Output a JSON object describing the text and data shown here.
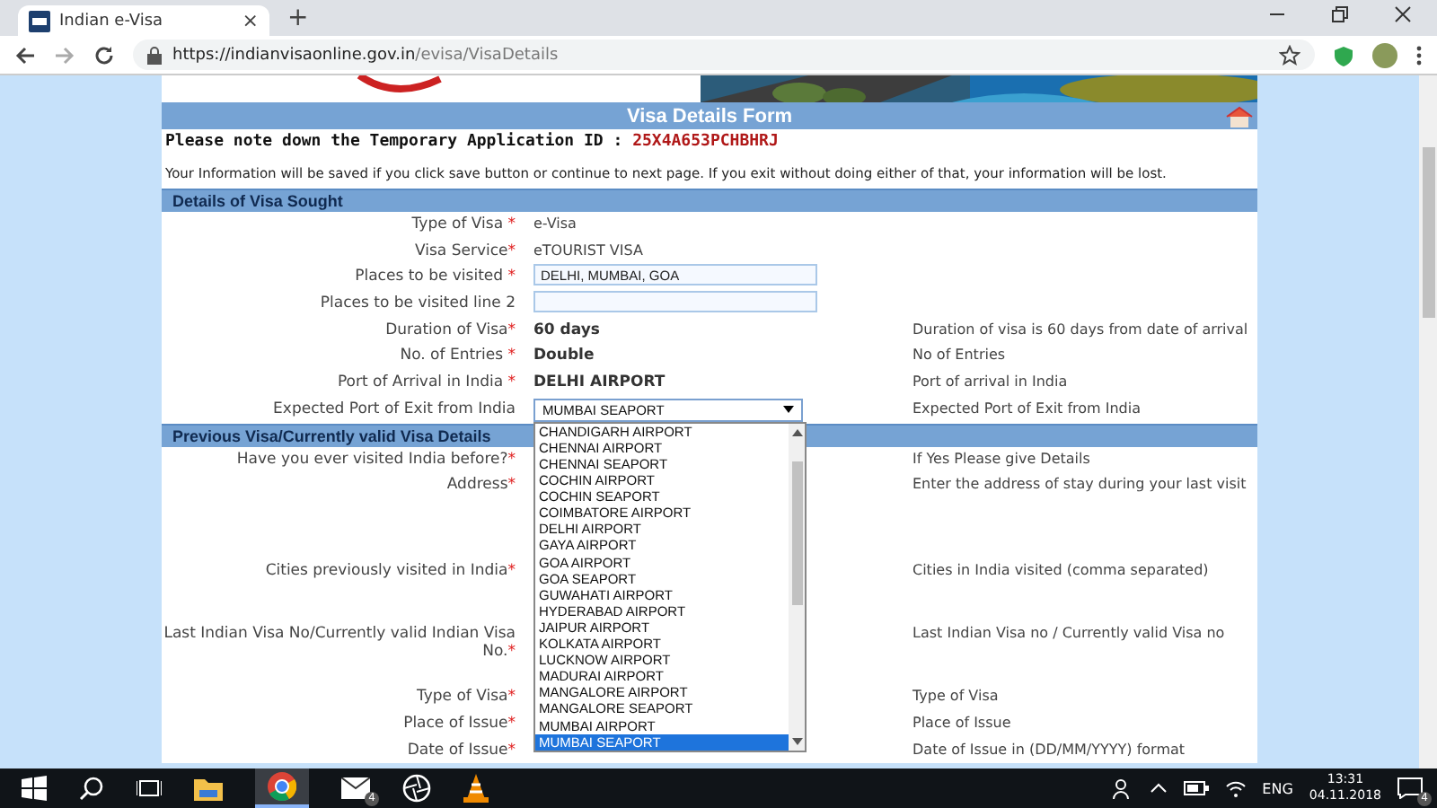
{
  "browser": {
    "tab_title": "Indian e-Visa",
    "close": "×",
    "new_tab": "+",
    "url_host": "https://indianvisaonline.gov.in",
    "url_path": "/evisa/VisaDetails"
  },
  "form": {
    "title": "Visa Details Form",
    "id_label": "Please note down the Temporary Application ID :",
    "id_value": "25X4A653PCHBHRJ",
    "info": "Your Information will be saved if you click save button or continue to next page. If you exit without doing either of that, your information will be lost.",
    "sections": [
      {
        "title": "Details of Visa Sought",
        "rows": [
          {
            "label": "Type of Visa ",
            "required": true,
            "kind": "text",
            "value": "e-Visa",
            "hint": ""
          },
          {
            "label": "Visa Service",
            "required": true,
            "kind": "text",
            "value": "eTOURIST VISA",
            "hint": ""
          },
          {
            "label": "Places to be visited ",
            "required": true,
            "kind": "input",
            "value": "DELHI, MUMBAI, GOA",
            "hint": ""
          },
          {
            "label": "Places to be visited line 2",
            "required": false,
            "kind": "input",
            "value": "",
            "hint": ""
          },
          {
            "label": "Duration of Visa",
            "required": true,
            "kind": "bold",
            "value": "60 days",
            "hint": "Duration of visa is 60 days from date of arrival"
          },
          {
            "label": "No. of Entries ",
            "required": true,
            "kind": "bold",
            "value": "Double",
            "hint": "No of Entries"
          },
          {
            "label": "Port of Arrival in India ",
            "required": true,
            "kind": "bold",
            "value": "DELHI AIRPORT",
            "hint": "Port of arrival in India"
          },
          {
            "label": "Expected Port of Exit from India",
            "required": false,
            "kind": "select",
            "value": "MUMBAI SEAPORT",
            "hint": "Expected Port of Exit from India",
            "expanded": true
          }
        ]
      },
      {
        "title": "Previous Visa/Currently valid Visa Details",
        "rows": [
          {
            "label": "Have you ever visited India before?",
            "required": true,
            "kind": "hidden",
            "hint": "If Yes Please give Details"
          },
          {
            "label": "Address",
            "required": true,
            "kind": "hidden",
            "hint": "Enter the address of stay during your last visit"
          },
          {
            "label": "Cities previously visited in India",
            "required": true,
            "kind": "hidden",
            "hint": "Cities in India visited (comma separated)"
          },
          {
            "label": "Last Indian Visa No/Currently valid Indian Visa No.",
            "required": true,
            "kind": "hidden",
            "hint": "Last Indian Visa no / Currently valid Visa no"
          },
          {
            "label": "Type of Visa",
            "required": true,
            "kind": "hidden",
            "hint": "Type of Visa"
          },
          {
            "label": "Place of Issue",
            "required": true,
            "kind": "hidden",
            "hint": "Place of Issue"
          },
          {
            "label": "Date of Issue",
            "required": true,
            "kind": "hidden",
            "hint": "Date of Issue in (DD/MM/YYYY) format"
          }
        ]
      }
    ],
    "required_mark": "*",
    "dropdown": [
      {
        "label": "CHANDIGARH AIRPORT",
        "selected": false
      },
      {
        "label": "CHENNAI AIRPORT",
        "selected": false
      },
      {
        "label": "CHENNAI SEAPORT",
        "selected": false
      },
      {
        "label": "COCHIN AIRPORT",
        "selected": false
      },
      {
        "label": "COCHIN SEAPORT",
        "selected": false
      },
      {
        "label": "COIMBATORE AIRPORT",
        "selected": false
      },
      {
        "label": "DELHI AIRPORT",
        "selected": false
      },
      {
        "label": "GAYA AIRPORT",
        "selected": false
      },
      {
        "label": "GOA AIRPORT",
        "selected": false
      },
      {
        "label": "GOA SEAPORT",
        "selected": false
      },
      {
        "label": "GUWAHATI AIRPORT",
        "selected": false
      },
      {
        "label": "HYDERABAD AIRPORT",
        "selected": false
      },
      {
        "label": "JAIPUR AIRPORT",
        "selected": false
      },
      {
        "label": "KOLKATA AIRPORT",
        "selected": false
      },
      {
        "label": "LUCKNOW AIRPORT",
        "selected": false
      },
      {
        "label": "MADURAI AIRPORT",
        "selected": false
      },
      {
        "label": "MANGALORE AIRPORT",
        "selected": false
      },
      {
        "label": "MANGALORE SEAPORT",
        "selected": false
      },
      {
        "label": "MUMBAI AIRPORT",
        "selected": false
      },
      {
        "label": "MUMBAI SEAPORT",
        "selected": true
      }
    ]
  },
  "taskbar": {
    "mail_badge": "4",
    "language": "ENG",
    "time": "13:31",
    "date": "04.11.2018",
    "notification_badge": "4"
  }
}
